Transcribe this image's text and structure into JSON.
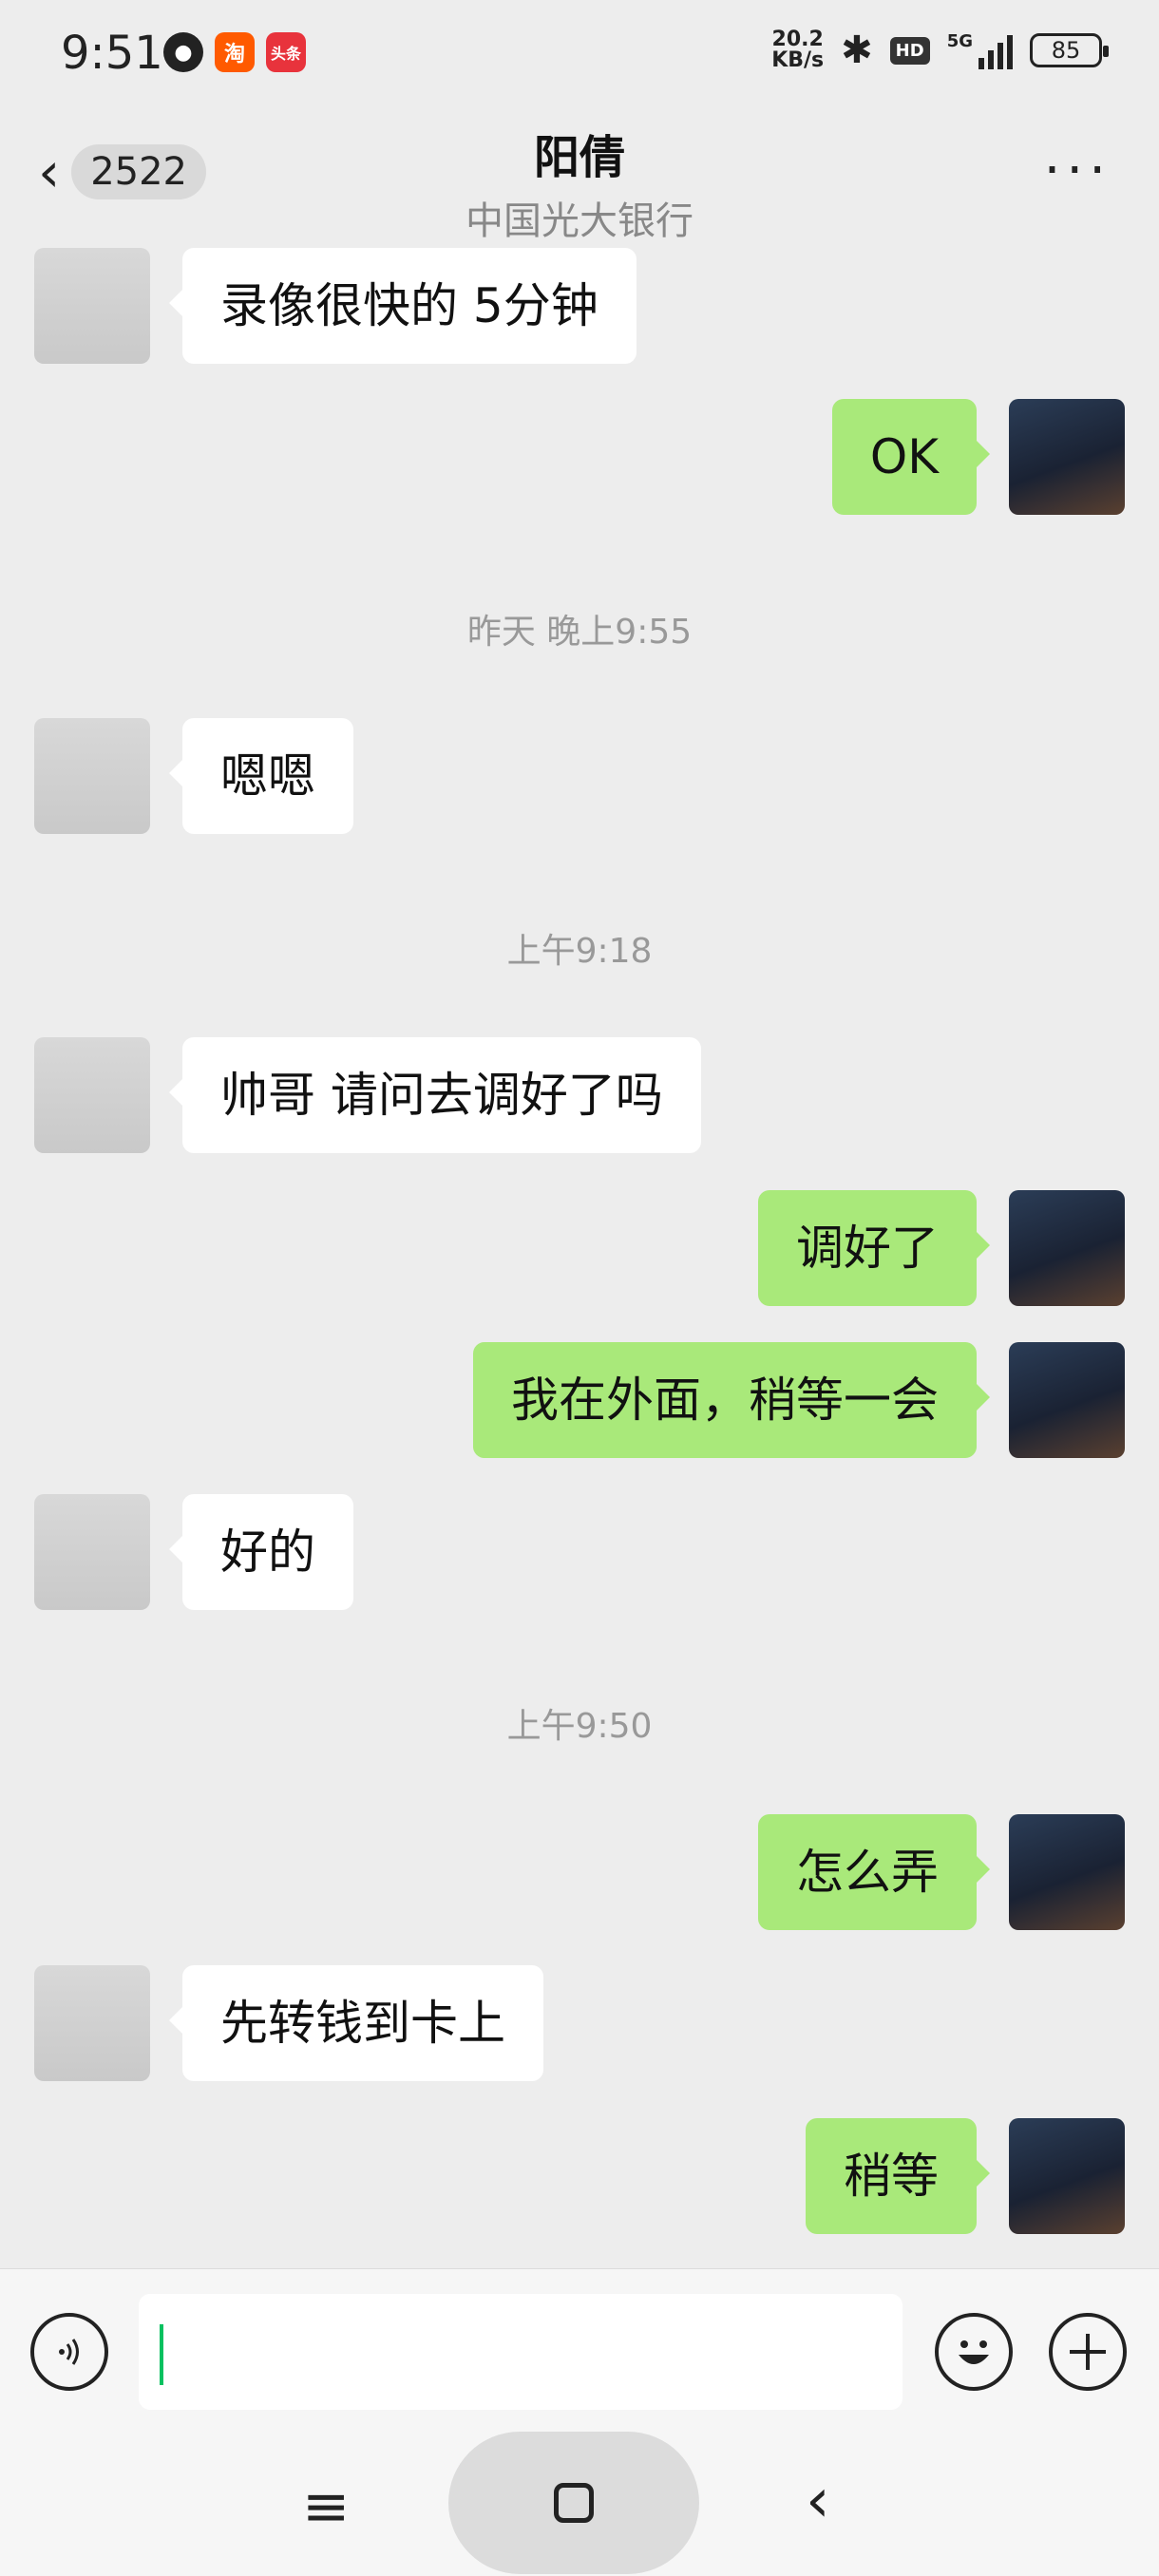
{
  "status_bar": {
    "time": "9:51",
    "net_speed_value": "20.2",
    "net_speed_unit": "KB/s",
    "hd_label": "HD",
    "signal_label": "5G",
    "battery": "85"
  },
  "header": {
    "unread_count": "2522",
    "contact_name": "阳倩",
    "contact_subtitle": "中国光大银行"
  },
  "messages": [
    {
      "side": "left",
      "text": "录像很快的 5分钟"
    },
    {
      "side": "right",
      "text": "OK"
    },
    {
      "timestamp": "昨天 晚上9:55"
    },
    {
      "side": "left",
      "text": "嗯嗯"
    },
    {
      "timestamp": "上午9:18"
    },
    {
      "side": "left",
      "text": "帅哥 请问去调好了吗"
    },
    {
      "side": "right",
      "text": "调好了"
    },
    {
      "side": "right",
      "text": "我在外面，稍等一会"
    },
    {
      "side": "left",
      "text": "好的"
    },
    {
      "timestamp": "上午9:50"
    },
    {
      "side": "right",
      "text": "怎么弄"
    },
    {
      "side": "left",
      "text": "先转钱到卡上"
    },
    {
      "side": "right",
      "text": "稍等"
    }
  ],
  "input": {
    "value": ""
  },
  "icons": {
    "voice": "voice-icon",
    "emoji": "emoji-icon",
    "plus": "plus-icon",
    "back": "back-chevron-icon",
    "more": "more-dots-icon"
  }
}
